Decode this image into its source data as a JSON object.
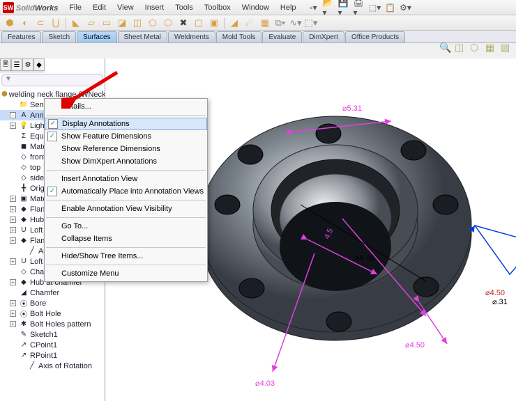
{
  "app": {
    "solid": "Solid",
    "works": "Works"
  },
  "menu": [
    "File",
    "Edit",
    "View",
    "Insert",
    "Tools",
    "Toolbox",
    "Window",
    "Help"
  ],
  "cmd_tabs": [
    "Features",
    "Sketch",
    "Surfaces",
    "Sheet Metal",
    "Weldments",
    "Mold Tools",
    "Evaluate",
    "DimXpert",
    "Office Products"
  ],
  "cmd_active": 2,
  "tree": {
    "root": "welding neck flange  (WNeck F",
    "items": [
      {
        "icon": "📁",
        "label": "Sensors",
        "ind": 1
      },
      {
        "icon": "A",
        "label": "Annot",
        "ind": 1,
        "sel": true,
        "exp": "-"
      },
      {
        "icon": "💡",
        "label": "Lights",
        "ind": 1,
        "exp": "+",
        "cut": true
      },
      {
        "icon": "Σ",
        "label": "Equati",
        "ind": 1,
        "cut": true
      },
      {
        "icon": "◼",
        "label": "Materi",
        "ind": 1,
        "cut": true
      },
      {
        "icon": "◇",
        "label": "front",
        "ind": 1,
        "cut": true
      },
      {
        "icon": "◇",
        "label": "top",
        "ind": 1,
        "cut": true
      },
      {
        "icon": "◇",
        "label": "side",
        "ind": 1,
        "cut": true
      },
      {
        "icon": "╋",
        "label": "Origin",
        "ind": 1,
        "cut": true
      },
      {
        "icon": "▣",
        "label": "MateR",
        "ind": 1,
        "exp": "+",
        "cut": true
      },
      {
        "icon": "◆",
        "label": "Flange",
        "ind": 1,
        "exp": "+",
        "cut": true
      },
      {
        "icon": "◆",
        "label": "Hub",
        "ind": 1,
        "exp": "+",
        "cut": true
      },
      {
        "icon": "U",
        "label": "Loft St",
        "ind": 1,
        "exp": "+",
        "cut": true
      },
      {
        "icon": "◆",
        "label": "Flange",
        "ind": 1,
        "exp": "+",
        "cut": true
      },
      {
        "icon": "╱",
        "label": "Axis of",
        "ind": 2,
        "cut": true
      },
      {
        "icon": "U",
        "label": "Loft",
        "ind": 1,
        "exp": "+"
      },
      {
        "icon": "◇",
        "label": "Chamfer Start Plane",
        "ind": 1
      },
      {
        "icon": "◆",
        "label": "Hub at chamfer",
        "ind": 1,
        "exp": "+"
      },
      {
        "icon": "◢",
        "label": "Chamfer",
        "ind": 1
      },
      {
        "icon": "⦿",
        "label": "Bore",
        "ind": 1,
        "exp": "+"
      },
      {
        "icon": "⦿",
        "label": "Bolt Hole",
        "ind": 1,
        "exp": "+"
      },
      {
        "icon": "✱",
        "label": "Bolt Holes pattern",
        "ind": 1,
        "exp": "+"
      },
      {
        "icon": "✎",
        "label": "Sketch1",
        "ind": 1
      },
      {
        "icon": "↗",
        "label": "CPoint1",
        "ind": 1
      },
      {
        "icon": "↗",
        "label": "RPoint1",
        "ind": 1
      },
      {
        "icon": "╱",
        "label": "Axis of Rotation",
        "ind": 2
      }
    ]
  },
  "context_menu": [
    {
      "type": "item",
      "label": "Details..."
    },
    {
      "type": "sep"
    },
    {
      "type": "check",
      "checked": true,
      "label": "Display Annotations",
      "hl": true
    },
    {
      "type": "check",
      "checked": true,
      "label": "Show Feature Dimensions"
    },
    {
      "type": "item",
      "label": "Show Reference Dimensions"
    },
    {
      "type": "item",
      "label": "Show DimXpert Annotations"
    },
    {
      "type": "sep"
    },
    {
      "type": "item",
      "label": "Insert Annotation View"
    },
    {
      "type": "check",
      "checked": true,
      "label": "Automatically Place into Annotation Views"
    },
    {
      "type": "sep"
    },
    {
      "type": "item",
      "label": "Enable Annotation View Visibility"
    },
    {
      "type": "sep"
    },
    {
      "type": "item",
      "label": "Go To..."
    },
    {
      "type": "item",
      "label": "Collapse Items"
    },
    {
      "type": "sep"
    },
    {
      "type": "item",
      "label": "Hide/Show Tree Items..."
    },
    {
      "type": "sep"
    },
    {
      "type": "item",
      "label": "Customize Menu"
    }
  ],
  "dimensions": {
    "d1": "⌀5.31",
    "d2": "⌀4.00",
    "d3": "⌀4.50",
    "d4": "⌀4.50",
    "d5": "⌀.31",
    "d6": "⌀4.03",
    "d7": "4.5"
  }
}
